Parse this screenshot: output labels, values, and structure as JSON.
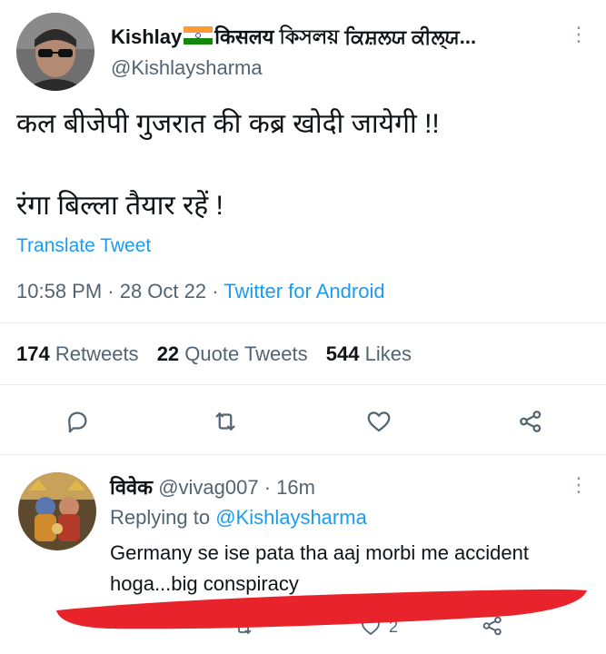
{
  "tweet": {
    "display_name": "Kishlay",
    "name_suffix": "किसलय কিসলয় ਕਿਸ਼ਲਯ ਕੀਲ੍ਯ...",
    "handle": "@Kishlaysharma",
    "text_line1": "कल बीजेपी गुजरात की कब्र खोदी जायेगी !!",
    "text_line2": "रंगा बिल्ला तैयार रहें !",
    "translate_label": "Translate Tweet",
    "time": "10:58 PM · 28 Oct 22 · ",
    "source": "Twitter for Android",
    "stats": {
      "retweets_count": "174",
      "retweets_label": "Retweets",
      "quotes_count": "22",
      "quotes_label": "Quote Tweets",
      "likes_count": "544",
      "likes_label": "Likes"
    }
  },
  "reply": {
    "display_name": "विवेक",
    "handle_time": "@vivag007 · 16m",
    "replying_prefix": "Replying to ",
    "replying_to": "@Kishlaysharma",
    "text_line1": "Germany se ise pata tha aaj morbi me accident",
    "text_line2": "hoga...big conspiracy",
    "like_count": "2"
  },
  "icons": {
    "more": "⋮",
    "reply": "reply-icon",
    "retweet": "retweet-icon",
    "like": "heart-icon",
    "share": "share-icon"
  },
  "colors": {
    "link": "#1d9bf0",
    "muted": "#536471",
    "annotation": "#e8232b"
  }
}
